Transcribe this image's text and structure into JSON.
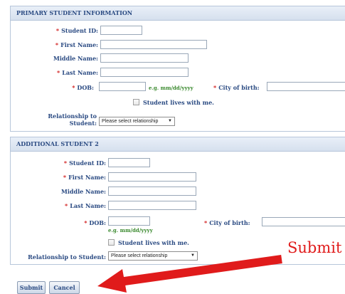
{
  "primary": {
    "header": "PRIMARY STUDENT INFORMATION",
    "student_id_label": "Student ID:",
    "first_name_label": "First Name:",
    "middle_name_label": "Middle Name:",
    "last_name_label": "Last Name:",
    "dob_label": "DOB:",
    "dob_hint": "e.g. mm/dd/yyyy",
    "city_label": "City of birth:",
    "lives_with_label": "Student lives with me.",
    "relationship_label_line1": "Relationship to",
    "relationship_label_line2": "Student:",
    "relationship_select": "Please select relationship"
  },
  "additional": {
    "header": "ADDITIONAL STUDENT 2",
    "student_id_label": "Student ID:",
    "first_name_label": "First Name:",
    "middle_name_label": "Middle Name:",
    "last_name_label": "Last Name:",
    "dob_label": "DOB:",
    "dob_hint": "e.g. mm/dd/yyyy",
    "city_label": "City of birth:",
    "lives_with_label": "Student lives with me.",
    "relationship_label": "Relationship to Student:",
    "relationship_select": "Please select relationship"
  },
  "required_marker": "*",
  "select_arrow": "▼",
  "actions": {
    "submit": "Submit",
    "cancel": "Cancel"
  },
  "annotation": {
    "text": "Submit",
    "color": "#e01b1b"
  }
}
